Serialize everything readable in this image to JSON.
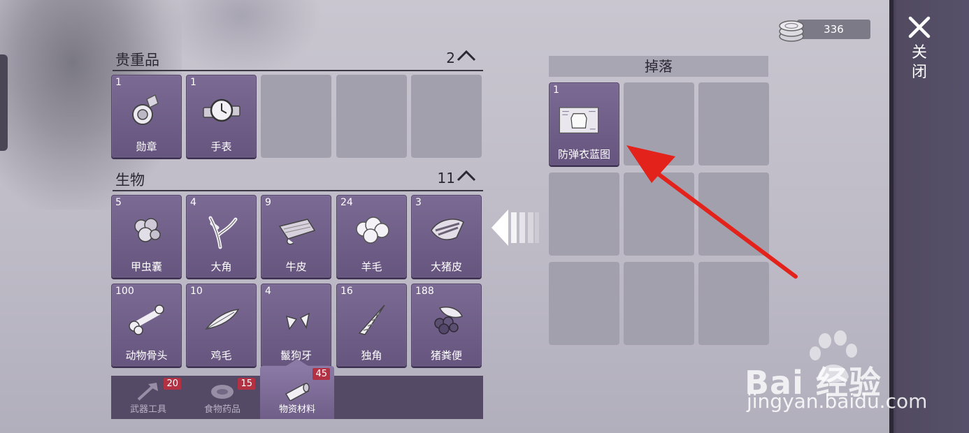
{
  "currency": {
    "value": "336",
    "icon": "coin-stack-icon"
  },
  "close": {
    "label": "关闭"
  },
  "sections": [
    {
      "title": "贵重品",
      "count": "2",
      "items": [
        {
          "count": "1",
          "name": "勋章",
          "icon": "medal-icon"
        },
        {
          "count": "1",
          "name": "手表",
          "icon": "watch-icon"
        }
      ]
    },
    {
      "title": "生物",
      "count": "11",
      "items": [
        {
          "count": "5",
          "name": "甲虫囊",
          "icon": "beetle-sac-icon"
        },
        {
          "count": "4",
          "name": "大角",
          "icon": "antler-icon"
        },
        {
          "count": "9",
          "name": "牛皮",
          "icon": "cowhide-icon"
        },
        {
          "count": "24",
          "name": "羊毛",
          "icon": "wool-icon"
        },
        {
          "count": "3",
          "name": "大猪皮",
          "icon": "pig-hide-icon"
        },
        {
          "count": "100",
          "name": "动物骨头",
          "icon": "bone-icon"
        },
        {
          "count": "10",
          "name": "鸡毛",
          "icon": "feather-icon"
        },
        {
          "count": "4",
          "name": "鬣狗牙",
          "icon": "fang-icon"
        },
        {
          "count": "16",
          "name": "独角",
          "icon": "horn-icon"
        },
        {
          "count": "188",
          "name": "猪粪便",
          "icon": "dung-icon"
        }
      ]
    }
  ],
  "tabs": [
    {
      "label": "武器工具",
      "badge": "20",
      "icon": "axe-icon",
      "active": false
    },
    {
      "label": "食物药品",
      "badge": "15",
      "icon": "meat-icon",
      "active": false
    },
    {
      "label": "物资材料",
      "badge": "45",
      "icon": "log-icon",
      "active": true
    }
  ],
  "drop": {
    "title": "掉落",
    "items": [
      {
        "count": "1",
        "name": "防弹衣蓝图",
        "icon": "vest-blueprint-icon"
      }
    ]
  },
  "watermark": {
    "brand": "Bai 经验",
    "url": "jingyan.baidu.com"
  },
  "colors": {
    "accent": "#6f5e88",
    "badge": "#b23244",
    "annotation_arrow": "#e3221c"
  }
}
